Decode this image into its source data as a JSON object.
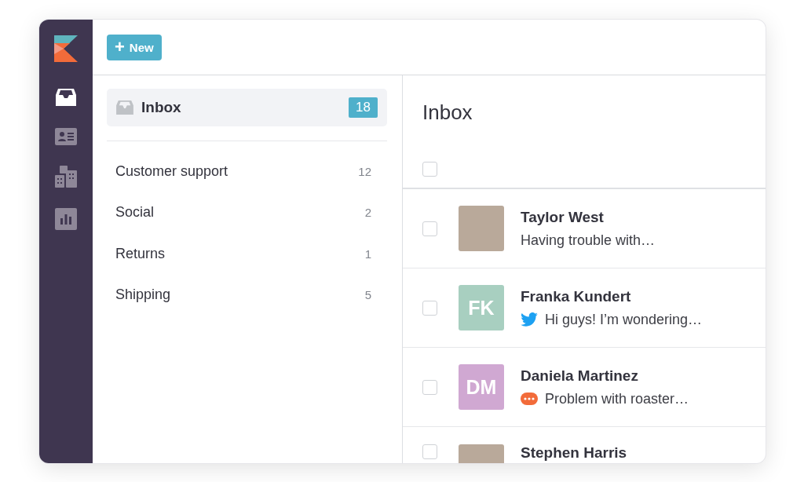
{
  "rail": {
    "items": [
      {
        "kind": "inbox",
        "selected": true
      },
      {
        "kind": "contact",
        "selected": false
      },
      {
        "kind": "buildings",
        "selected": false
      },
      {
        "kind": "chart",
        "selected": false
      }
    ]
  },
  "toolbar": {
    "new_button": {
      "icon": "+",
      "label": "New"
    }
  },
  "folders": {
    "inbox": {
      "label": "Inbox",
      "count": "18",
      "selected": true
    },
    "items": [
      {
        "label": "Customer support",
        "count": "12"
      },
      {
        "label": "Social",
        "count": "2"
      },
      {
        "label": "Returns",
        "count": "1"
      },
      {
        "label": "Shipping",
        "count": "5"
      }
    ]
  },
  "conversations": {
    "title": "Inbox",
    "select_all": {
      "checked": false
    },
    "rows": [
      {
        "name": "Taylor West",
        "preview": "Having trouble with…",
        "avatar": {
          "kind": "photo"
        },
        "checked": false
      },
      {
        "name": "Franka Kundert",
        "preview": "Hi guys! I’m wondering…",
        "avatar": {
          "kind": "initials",
          "initials": "FK",
          "color": "#a8cfc0"
        },
        "channel": {
          "kind": "twitter"
        },
        "checked": false
      },
      {
        "name": "Daniela Martinez",
        "preview": "Problem with roaster…",
        "avatar": {
          "kind": "initials",
          "initials": "DM",
          "color": "#d0a8d2"
        },
        "channel": {
          "kind": "chat"
        },
        "checked": false
      },
      {
        "name": "Stephen Harris",
        "avatar": {
          "kind": "photo"
        },
        "checked": false
      }
    ]
  }
}
